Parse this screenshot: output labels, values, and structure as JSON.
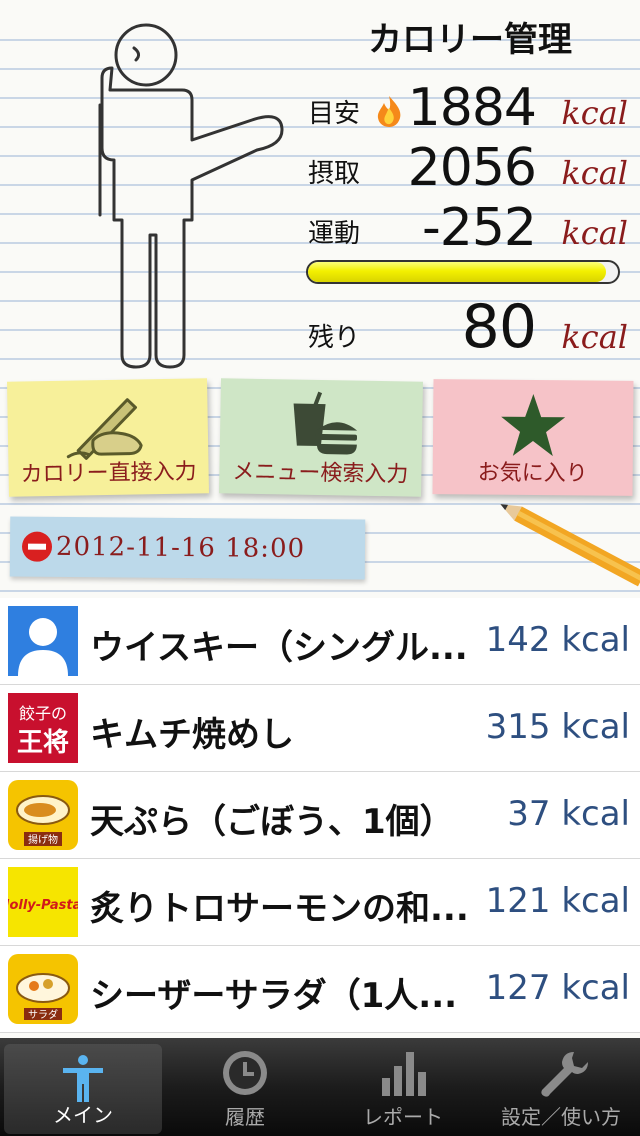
{
  "header": {
    "title": "カロリー管理"
  },
  "stats": [
    {
      "label": "目安",
      "value": "1884",
      "unit": "kcal"
    },
    {
      "label": "摂取",
      "value": "2056",
      "unit": "kcal"
    },
    {
      "label": "運動",
      "value": "-252",
      "unit": "kcal"
    }
  ],
  "progress": {
    "fraction": 0.96
  },
  "remaining": {
    "label": "残り",
    "value": "80",
    "unit": "kcal"
  },
  "actions": {
    "direct_input": "カロリー直接入力",
    "menu_search": "メニュー検索入力",
    "favorites": "お気に入り"
  },
  "date": {
    "text": "2012-11-16 18:00"
  },
  "entries": [
    {
      "name": "ウイスキー（シングル...",
      "kcal": "142 kcal",
      "icon": "user-avatar-icon"
    },
    {
      "name": "キムチ焼めし",
      "kcal": "315 kcal",
      "icon": "gyoza-no-ohsho-logo"
    },
    {
      "name": "天ぷら（ごぼう、1個）",
      "kcal": "37 kcal",
      "icon": "fried-food-icon"
    },
    {
      "name": "炙りトロサーモンの和...",
      "kcal": "121 kcal",
      "icon": "jolly-pasta-logo"
    },
    {
      "name": "シーザーサラダ（1人...",
      "kcal": "127 kcal",
      "icon": "salad-icon"
    }
  ],
  "logos": {
    "ohsho_text": "餃子の王将",
    "jolly_text": "Jolly-Pasta",
    "fried_text": "揚げ物",
    "salad_text": "サラダ"
  },
  "tabs": [
    {
      "label": "メイン",
      "icon": "person-icon",
      "active": true
    },
    {
      "label": "履歴",
      "icon": "clock-icon",
      "active": false
    },
    {
      "label": "レポート",
      "icon": "bar-chart-icon",
      "active": false
    },
    {
      "label": "設定／使い方",
      "icon": "wrench-icon",
      "active": false
    }
  ],
  "colors": {
    "unit": "#8a1c1c",
    "kcal_list": "#2e4f80",
    "progress": "#f3f000"
  }
}
